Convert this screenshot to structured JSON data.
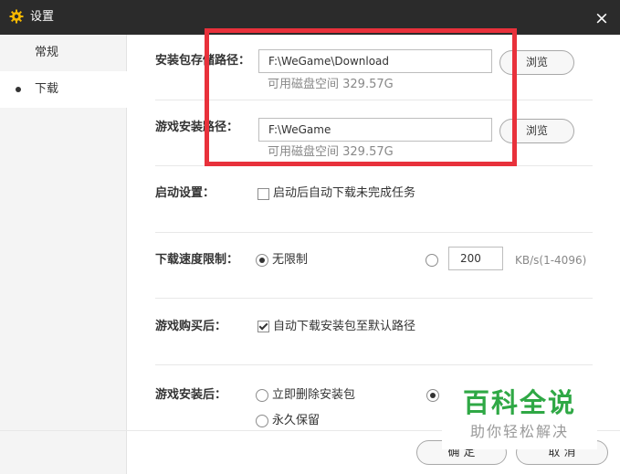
{
  "window": {
    "title": "设置",
    "close_glyph": "×"
  },
  "sidebar": {
    "items": [
      {
        "label": "常规",
        "active": false
      },
      {
        "label": "下载",
        "active": true
      }
    ]
  },
  "download_path": {
    "label": "安装包存储路径：",
    "value": "F:\\WeGame\\Download",
    "browse_label": "浏览",
    "hint": "可用磁盘空间 329.57G"
  },
  "install_path": {
    "label": "游戏安装路径：",
    "value": "F:\\WeGame",
    "browse_label": "浏览",
    "hint": "可用磁盘空间 329.57G"
  },
  "startup": {
    "label": "启动设置：",
    "option": "启动后自动下载未完成任务",
    "checked": false
  },
  "speed_limit": {
    "label": "下载速度限制：",
    "unlimited_label": "无限制",
    "unlimited_selected": true,
    "limit_value": "200",
    "unit": "KB/s(1-4096)"
  },
  "after_purchase": {
    "label": "游戏购买后：",
    "option": "自动下载安装包至默认路径",
    "checked": true
  },
  "after_install": {
    "label": "游戏安装后：",
    "option_delete": "立即删除安装包",
    "option_keep": "永久保留",
    "third_option_selected": true
  },
  "footer": {
    "confirm_label": "确 定",
    "cancel_label": "取 消"
  },
  "watermark": {
    "title": "百科全说",
    "subtitle": "助你轻松解决"
  },
  "colors": {
    "titlebar": "#2b2b2b",
    "highlight": "#e8313b",
    "watermark_green": "#2fa845",
    "gear_icon": "#f5b800"
  },
  "icons": {
    "title": "gear-icon",
    "close": "close-icon"
  }
}
